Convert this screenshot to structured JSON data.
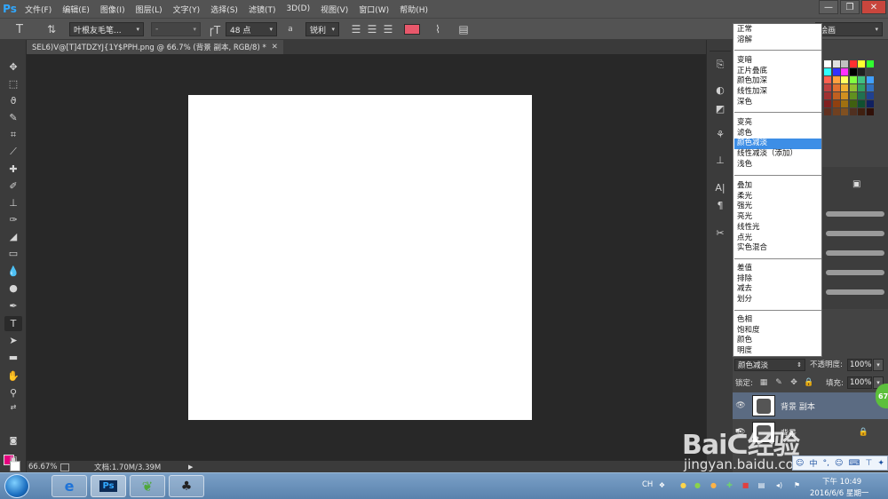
{
  "app": {
    "logo": "Ps",
    "menu": [
      "文件(F)",
      "编辑(E)",
      "图像(I)",
      "图层(L)",
      "文字(Y)",
      "选择(S)",
      "滤镜(T)",
      "3D(D)",
      "视图(V)",
      "窗口(W)",
      "帮助(H)"
    ],
    "window_controls": {
      "minimize": "—",
      "restore": "❐",
      "close": "✕"
    }
  },
  "options": {
    "tool_icon": "T",
    "font_family": "叶根友毛笔...",
    "font_style": "-",
    "font_size": "48 点",
    "aa_label": "a",
    "aa_mode": "锐利",
    "text_color": "#e8586b",
    "workspace": "绘画"
  },
  "document": {
    "tab_title": "SEL6)V@[T]4TDZYJ{1Y$PPH.png @ 66.7% (背景 副本, RGB/8) *",
    "zoom": "66.67%",
    "doc_info": "文档:1.70M/3.39M"
  },
  "blend_modes": {
    "selected": "颜色减淡",
    "groups": [
      [
        "正常",
        "溶解"
      ],
      [
        "变暗",
        "正片叠底",
        "颜色加深",
        "线性加深",
        "深色"
      ],
      [
        "变亮",
        "滤色",
        "颜色减淡",
        "线性减淡（添加）",
        "浅色"
      ],
      [
        "叠加",
        "柔光",
        "强光",
        "亮光",
        "线性光",
        "点光",
        "实色混合"
      ],
      [
        "差值",
        "排除",
        "减去",
        "划分"
      ],
      [
        "色相",
        "饱和度",
        "颜色",
        "明度"
      ]
    ]
  },
  "layers": {
    "blend_mode": "颜色减淡",
    "opacity_label": "不透明度:",
    "opacity": "100%",
    "lock_label": "锁定:",
    "fill_label": "填充:",
    "fill": "100%",
    "items": [
      {
        "name": "背景 副本",
        "selected": true
      },
      {
        "name": "背景",
        "selected": false
      }
    ]
  },
  "badge": "67",
  "watermark": {
    "logo": "Baiᑖ经验",
    "sub": "jingyan.baidu.com"
  },
  "ime": {
    "label": "中"
  },
  "taskbar": {
    "lang": "CH",
    "time": "下午 10:49",
    "date": "2016/6/6 星期一",
    "apps": [
      "ie",
      "photoshop",
      "leaf",
      "qq"
    ]
  }
}
